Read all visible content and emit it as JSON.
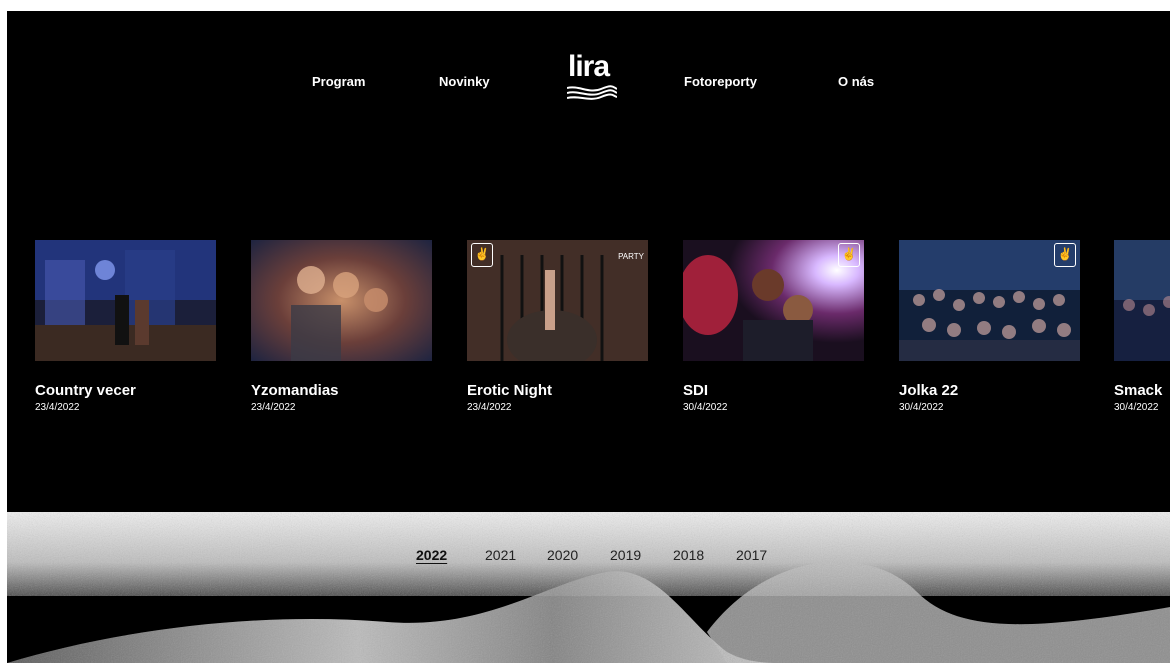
{
  "nav": {
    "items": [
      {
        "label": "Program"
      },
      {
        "label": "Novinky"
      },
      {
        "label": "Fotoreporty"
      },
      {
        "label": "O nás"
      }
    ],
    "logo_text": "lira"
  },
  "gallery": {
    "items": [
      {
        "title": "Country vecer",
        "date": "23/4/2022",
        "thumb_colors": [
          "#1d2a6b",
          "#3b4a9c",
          "#5a2f5e"
        ]
      },
      {
        "title": "Yzomandias",
        "date": "23/4/2022",
        "thumb_colors": [
          "#5a3b2a",
          "#a86a4a",
          "#3b2f4d"
        ]
      },
      {
        "title": "Erotic Night",
        "date": "23/4/2022",
        "thumb_colors": [
          "#2a2220",
          "#6b4a3e",
          "#4b3a33"
        ],
        "badge_text": "PARTY"
      },
      {
        "title": "SDI",
        "date": "30/4/2022",
        "thumb_colors": [
          "#3a1a3a",
          "#b02a5a",
          "#d8d8e8"
        ]
      },
      {
        "title": "Jolka 22",
        "date": "30/4/2022",
        "thumb_colors": [
          "#12233d",
          "#2f4a7a",
          "#7a6a80"
        ]
      },
      {
        "title": "Smack",
        "date": "30/4/2022",
        "thumb_colors": [
          "#1a2440",
          "#3a4f7f",
          "#6a5a7a"
        ]
      }
    ]
  },
  "years": {
    "items": [
      {
        "label": "2022",
        "active": true
      },
      {
        "label": "2021"
      },
      {
        "label": "2020"
      },
      {
        "label": "2019"
      },
      {
        "label": "2018"
      },
      {
        "label": "2017"
      }
    ]
  },
  "icons": {
    "rock_hand": "rock-hand-icon"
  },
  "colors": {
    "background": "#000000",
    "text": "#ffffff",
    "year_text": "#222222"
  }
}
